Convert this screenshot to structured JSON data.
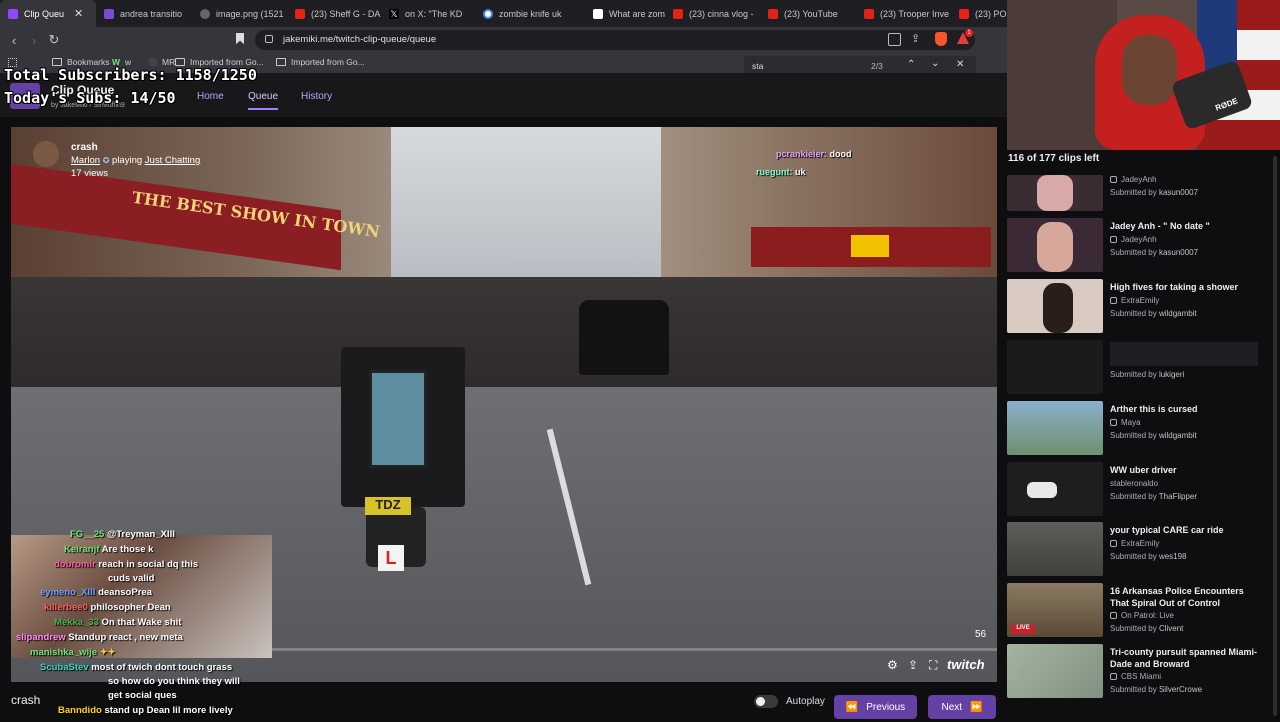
{
  "tabs": [
    {
      "label": "Clip Queu",
      "fav": "#9146ff",
      "active": true,
      "close": "✕"
    },
    {
      "label": "andrea transitio",
      "fav": "#7b4bd8"
    },
    {
      "label": "image.png (1521",
      "fav": "#888"
    },
    {
      "label": "(23) Sheff G - DA",
      "fav": "#e62117"
    },
    {
      "label": "on X: \"The KD",
      "fav": "#111"
    },
    {
      "label": "zombie knife uk",
      "fav": "#4285f4"
    },
    {
      "label": "What are zombi",
      "fav": "#fff"
    },
    {
      "label": "(23) cinna vlog -",
      "fav": "#e62117"
    },
    {
      "label": "(23) YouTube",
      "fav": "#e62117"
    },
    {
      "label": "(23) Trooper Inve",
      "fav": "#e62117"
    },
    {
      "label": "(23) POLI",
      "fav": "#e62117"
    }
  ],
  "url": "jakemiki.me/twitch-clip-queue/queue",
  "bookmarks": [
    "Bookmarks",
    "w",
    "MR",
    "Imported from Go...",
    "Imported from Go..."
  ],
  "find": {
    "query": "sta",
    "count": "2/3"
  },
  "overlay": {
    "total_subs": "Total Subscribers: 1158/1250",
    "today_subs": "Today's Subs: 14/50"
  },
  "app": {
    "title": "Clip Queue",
    "byline": "by",
    "author1": "JakeMiki",
    "author2": "SirMuffin9"
  },
  "nav": {
    "home": "Home",
    "queue": "Queue",
    "history": "History"
  },
  "clip": {
    "title": "crash",
    "broadcaster": "Marlon",
    "playing": "playing",
    "game": "Just Chatting",
    "views": "17 views",
    "timer": "56",
    "bottom_title": "crash",
    "twitch_brand": "twitch"
  },
  "video_chat": [
    {
      "user": "pcrankieier:",
      "msg": "dood",
      "color": "#e0a0ff"
    },
    {
      "user": "ruegunt:",
      "msg": "uk",
      "color": "#7fffd4"
    }
  ],
  "chat": [
    {
      "user": "FG__25",
      "msg": "@Treyman_XIII",
      "ucolor": "#6ee37b"
    },
    {
      "user": "Keiranjf",
      "msg": "Are those k",
      "ucolor": "#6ee37b"
    },
    {
      "user": "dobromir",
      "msg": "reach in social dq this",
      "ucolor": "#ff5ba0"
    },
    {
      "user": "",
      "msg": "cuds valid",
      "ucolor": "#fff"
    },
    {
      "user": "eymeno_XIII",
      "msg": "deansoPrea",
      "ucolor": "#6ea0ff"
    },
    {
      "user": "killerbee0",
      "msg": "philosopher Dean",
      "ucolor": "#ff6060"
    },
    {
      "user": "Mekka_33",
      "msg": "On that Wake shit",
      "ucolor": "#4caf50"
    },
    {
      "user": "slipandrew",
      "msg": "Standup react , new meta",
      "ucolor": "#ff8af0"
    },
    {
      "user": "manishka_wije",
      "msg": "",
      "ucolor": "#6ee37b"
    },
    {
      "user": "ScubaStev",
      "msg": "most of twich dont touch grass",
      "ucolor": "#3fd0c0"
    },
    {
      "user": "",
      "msg": "so how do you think they will",
      "ucolor": "#fff"
    },
    {
      "user": "",
      "msg": "get social ques",
      "ucolor": "#fff"
    },
    {
      "user": "Banndido",
      "msg": "stand up Dean lil more lively",
      "ucolor": "#ffd700"
    }
  ],
  "queue": {
    "count": "116 of 177 clips left",
    "clips": [
      {
        "title": "",
        "channel": "JadeyAnh",
        "submitted_by": "kasun0007",
        "thumb": "#3a2c30"
      },
      {
        "title": "Jadey Anh - \" No date \"",
        "channel": "JadeyAnh",
        "submitted_by": "kasun0007",
        "thumb": "#3b2a35"
      },
      {
        "title": "High fives for taking a shower",
        "channel": "ExtraEmily",
        "submitted_by": "wildgambit",
        "thumb": "#d9cbc2"
      },
      {
        "title": "",
        "channel": "",
        "submitted_by": "lukigeri",
        "thumb": "#1b1b1e"
      },
      {
        "title": "Arther this is cursed",
        "channel": "Maya",
        "submitted_by": "wildgambit",
        "thumb": "#6f8fa8"
      },
      {
        "title": "WW uber driver",
        "channel": "stableronaldo",
        "submitted_by": "ThaFlipper",
        "thumb": "#2a2a2a"
      },
      {
        "title": "your typical CARE car ride",
        "channel": "ExtraEmily",
        "submitted_by": "wes198",
        "thumb": "#6c6f66"
      },
      {
        "title": "16 Arkansas Police Encounters That Spiral Out of Control",
        "channel": "On Patrol: Live",
        "submitted_by": "Clivent",
        "thumb": "#7a6a52"
      },
      {
        "title": "Tri-county pursuit spanned Miami-Dade and Broward",
        "channel": "CBS Miami",
        "submitted_by": "SilverCrowe",
        "thumb": "#8aa08a"
      }
    ],
    "submitted_prefix": "Submitted by"
  },
  "controls": {
    "autoplay": "Autoplay",
    "previous": "Previous",
    "next": "Next"
  },
  "cam": {
    "mic_label": "RØDE"
  }
}
